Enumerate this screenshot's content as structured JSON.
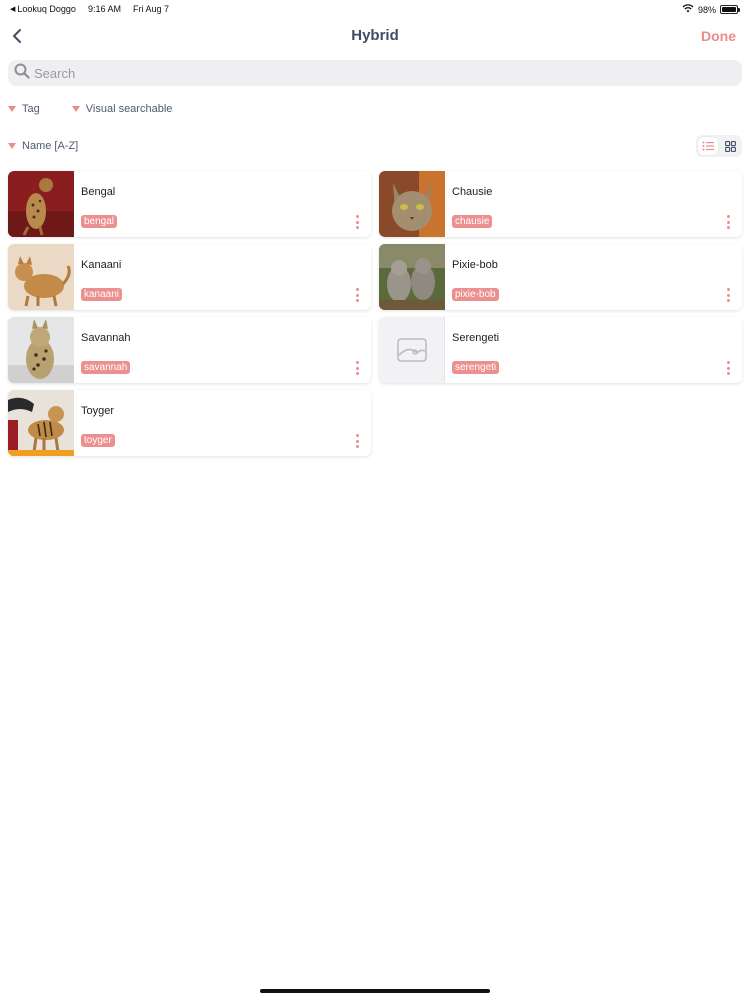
{
  "status_bar": {
    "back_app": "Lookuq Doggo",
    "time": "9:16 AM",
    "date": "Fri Aug 7",
    "battery": "98%",
    "battery_level": 0.98
  },
  "nav": {
    "title": "Hybrid",
    "done_label": "Done"
  },
  "search": {
    "placeholder": "Search"
  },
  "filters": {
    "tag_label": "Tag",
    "visual_label": "Visual searchable",
    "sort_label": "Name [A-Z]"
  },
  "view_mode": "grid",
  "items": [
    {
      "name": "Bengal",
      "tag": "bengal"
    },
    {
      "name": "Chausie",
      "tag": "chausie"
    },
    {
      "name": "Kanaani",
      "tag": "kanaani"
    },
    {
      "name": "Pixie-bob",
      "tag": "pixie-bob"
    },
    {
      "name": "Savannah",
      "tag": "savannah"
    },
    {
      "name": "Serengeti",
      "tag": "serengeti"
    },
    {
      "name": "Toyger",
      "tag": "toyger"
    }
  ],
  "colors": {
    "accent": "#ef8a8a",
    "title": "#3f4d66",
    "tag_bg": "#ec8f8f"
  }
}
